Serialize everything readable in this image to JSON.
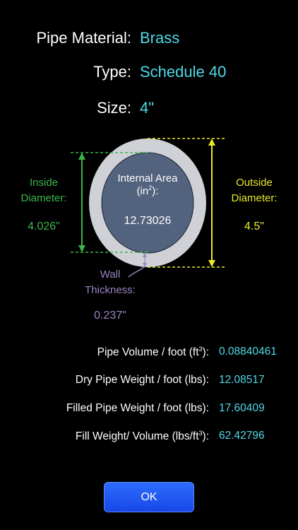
{
  "header": {
    "material_label": "Pipe Material:",
    "material_value": "Brass",
    "type_label": "Type:",
    "type_value": "Schedule 40",
    "size_label": "Size:",
    "size_value": "4\""
  },
  "diagram": {
    "internal_area_label_line1": "Internal Area",
    "internal_area_label_line2_prefix": "(in",
    "internal_area_label_sup": "2",
    "internal_area_label_line2_suffix": "):",
    "internal_area_value": "12.73026",
    "inside_diameter_line1": "Inside",
    "inside_diameter_line2": "Diameter:",
    "inside_diameter_value": "4.026\"",
    "outside_diameter_line1": "Outside",
    "outside_diameter_line2": "Diameter:",
    "outside_diameter_value": "4.5\"",
    "wall_line1": "Wall",
    "wall_line2": "Thickness:",
    "wall_value": "0.237\""
  },
  "results": [
    {
      "label_prefix": "Pipe Volume / foot (ft",
      "label_sup": "3",
      "label_suffix": "):",
      "value": "0.08840461"
    },
    {
      "label_prefix": "Dry Pipe Weight / foot (lbs):",
      "label_sup": "",
      "label_suffix": "",
      "value": "12.08517"
    },
    {
      "label_prefix": "Filled Pipe Weight / foot (lbs):",
      "label_sup": "",
      "label_suffix": "",
      "value": "17.60409"
    },
    {
      "label_prefix": "Fill Weight/ Volume (lbs/ft",
      "label_sup": "3",
      "label_suffix": "):",
      "value": "62.42796"
    }
  ],
  "ok_label": "OK",
  "colors": {
    "value_cyan": "#4fd9e8",
    "inside_green": "#3bb54a",
    "outside_yellow": "#e8e82a",
    "wall_purple": "#9a86c4",
    "button_blue": "#1f55f0"
  }
}
